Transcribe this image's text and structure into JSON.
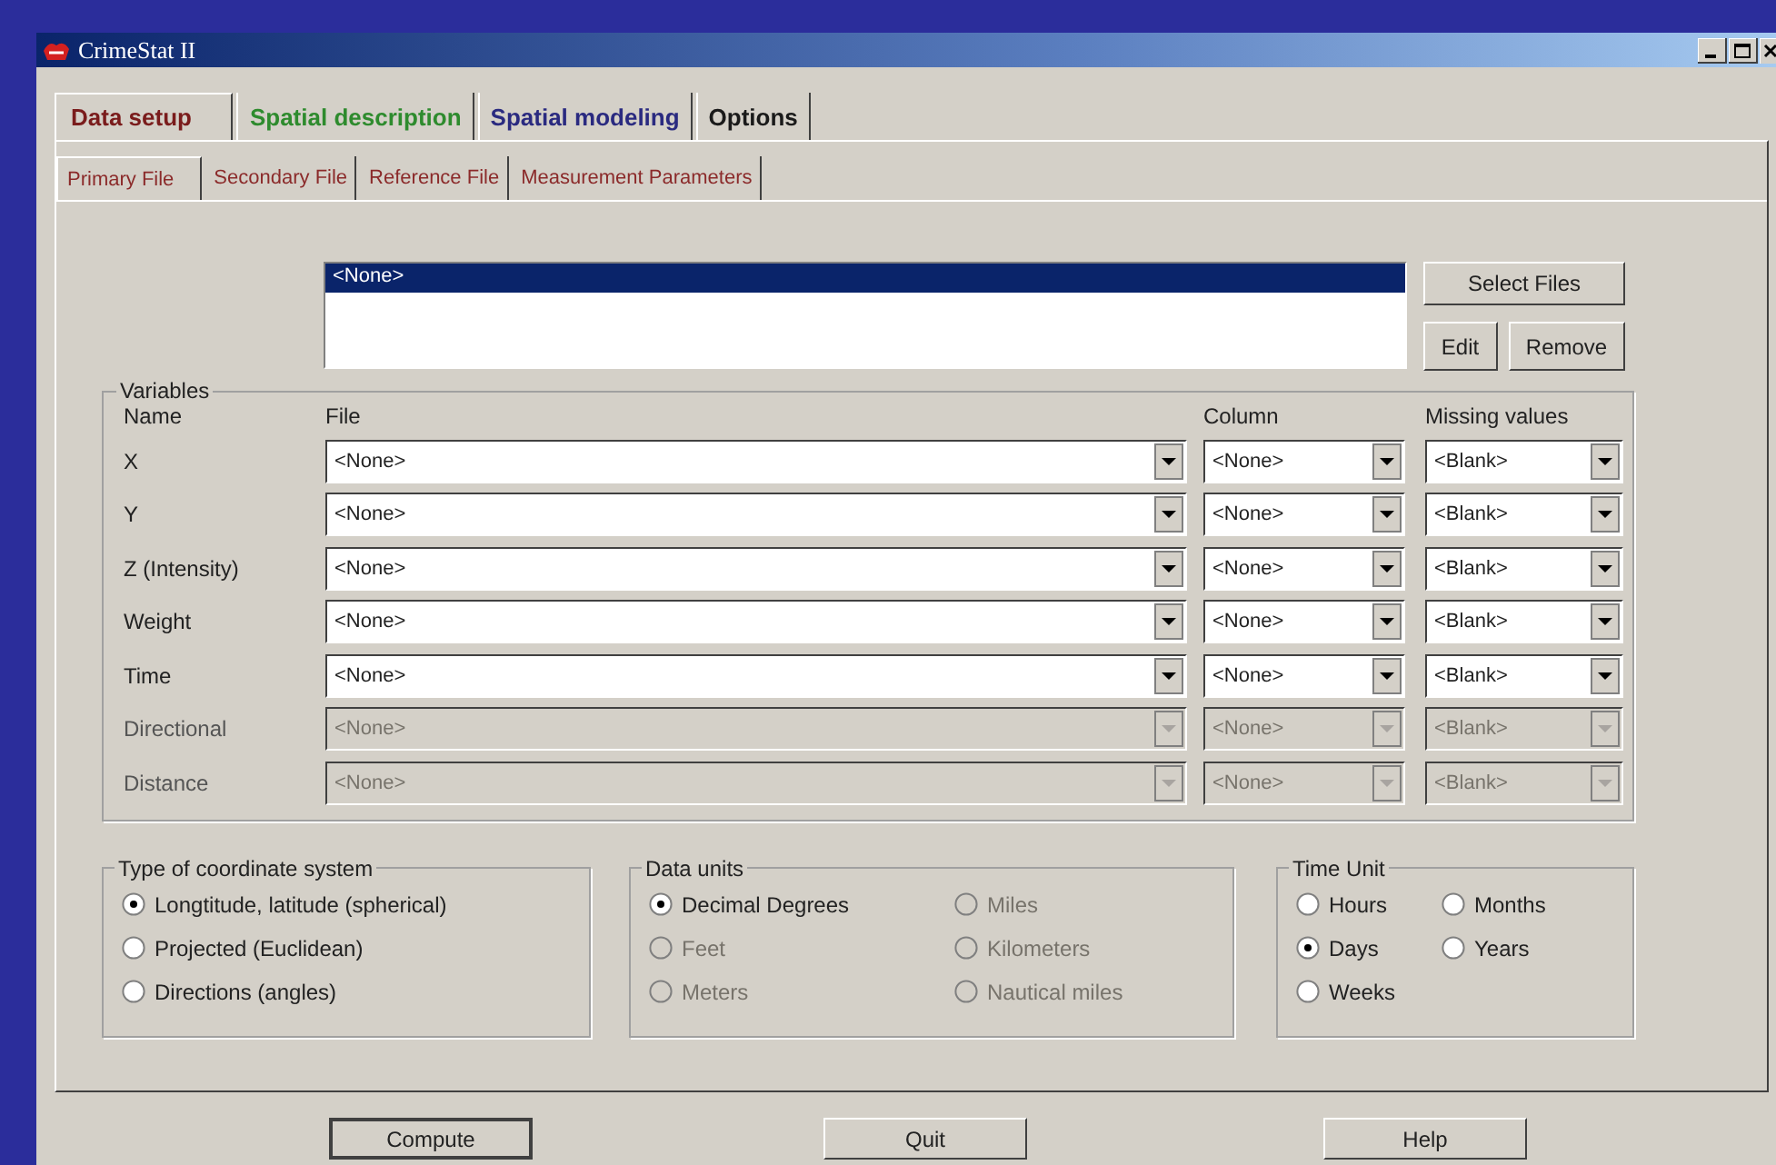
{
  "window": {
    "title": "CrimeStat II"
  },
  "main_tabs": [
    {
      "label": "Data setup",
      "selected": true,
      "color": "#7a1c1c"
    },
    {
      "label": "Spatial description",
      "selected": false,
      "color": "#2e8b2e"
    },
    {
      "label": "Spatial modeling",
      "selected": false,
      "color": "#2a2a80"
    },
    {
      "label": "Options",
      "selected": false,
      "color": "#1a1a1a"
    }
  ],
  "sub_tabs": [
    {
      "label": "Primary File",
      "selected": true
    },
    {
      "label": "Secondary File",
      "selected": false
    },
    {
      "label": "Reference File",
      "selected": false
    },
    {
      "label": "Measurement Parameters",
      "selected": false
    }
  ],
  "file_list": {
    "items": [
      {
        "label": "<None>",
        "selected": true
      }
    ]
  },
  "file_buttons": [
    {
      "label": "Select Files",
      "kind": "wide"
    },
    {
      "label": "Edit",
      "kind": "small"
    },
    {
      "label": "Remove",
      "kind": "small"
    }
  ],
  "variables": {
    "title": "Variables",
    "headers": {
      "name": "Name",
      "file": "File",
      "column": "Column",
      "missing": "Missing values"
    },
    "rows": [
      {
        "name": "X",
        "file": "<None>",
        "column": "<None>",
        "missing": "<Blank>",
        "disabled": false
      },
      {
        "name": "Y",
        "file": "<None>",
        "column": "<None>",
        "missing": "<Blank>",
        "disabled": false
      },
      {
        "name": "Z (Intensity)",
        "file": "<None>",
        "column": "<None>",
        "missing": "<Blank>",
        "disabled": false
      },
      {
        "name": "Weight",
        "file": "<None>",
        "column": "<None>",
        "missing": "<Blank>",
        "disabled": false
      },
      {
        "name": "Time",
        "file": "<None>",
        "column": "<None>",
        "missing": "<Blank>",
        "disabled": false
      },
      {
        "name": "Directional",
        "file": "<None>",
        "column": "<None>",
        "missing": "<Blank>",
        "disabled": true
      },
      {
        "name": "Distance",
        "file": "<None>",
        "column": "<None>",
        "missing": "<Blank>",
        "disabled": true
      }
    ]
  },
  "coordinate_system": {
    "title": "Type of coordinate system",
    "options": [
      {
        "label": "Longtitude, latitude (spherical)",
        "selected": true,
        "disabled": false
      },
      {
        "label": "Projected (Euclidean)",
        "selected": false,
        "disabled": false
      },
      {
        "label": "Directions (angles)",
        "selected": false,
        "disabled": false
      }
    ]
  },
  "data_units": {
    "title": "Data units",
    "options": [
      {
        "label": "Decimal Degrees",
        "selected": true,
        "disabled": false
      },
      {
        "label": "Miles",
        "selected": false,
        "disabled": true
      },
      {
        "label": "Feet",
        "selected": false,
        "disabled": true
      },
      {
        "label": "Kilometers",
        "selected": false,
        "disabled": true
      },
      {
        "label": "Meters",
        "selected": false,
        "disabled": true
      },
      {
        "label": "Nautical miles",
        "selected": false,
        "disabled": true
      }
    ]
  },
  "time_unit": {
    "title": "Time Unit",
    "options": [
      {
        "label": "Hours",
        "selected": false,
        "disabled": false
      },
      {
        "label": "Months",
        "selected": false,
        "disabled": false
      },
      {
        "label": "Days",
        "selected": true,
        "disabled": false
      },
      {
        "label": "Years",
        "selected": false,
        "disabled": false
      },
      {
        "label": "Weeks",
        "selected": false,
        "disabled": false
      }
    ]
  },
  "buttons": [
    {
      "label": "Compute",
      "default": true
    },
    {
      "label": "Quit",
      "default": false
    },
    {
      "label": "Help",
      "default": false
    }
  ]
}
